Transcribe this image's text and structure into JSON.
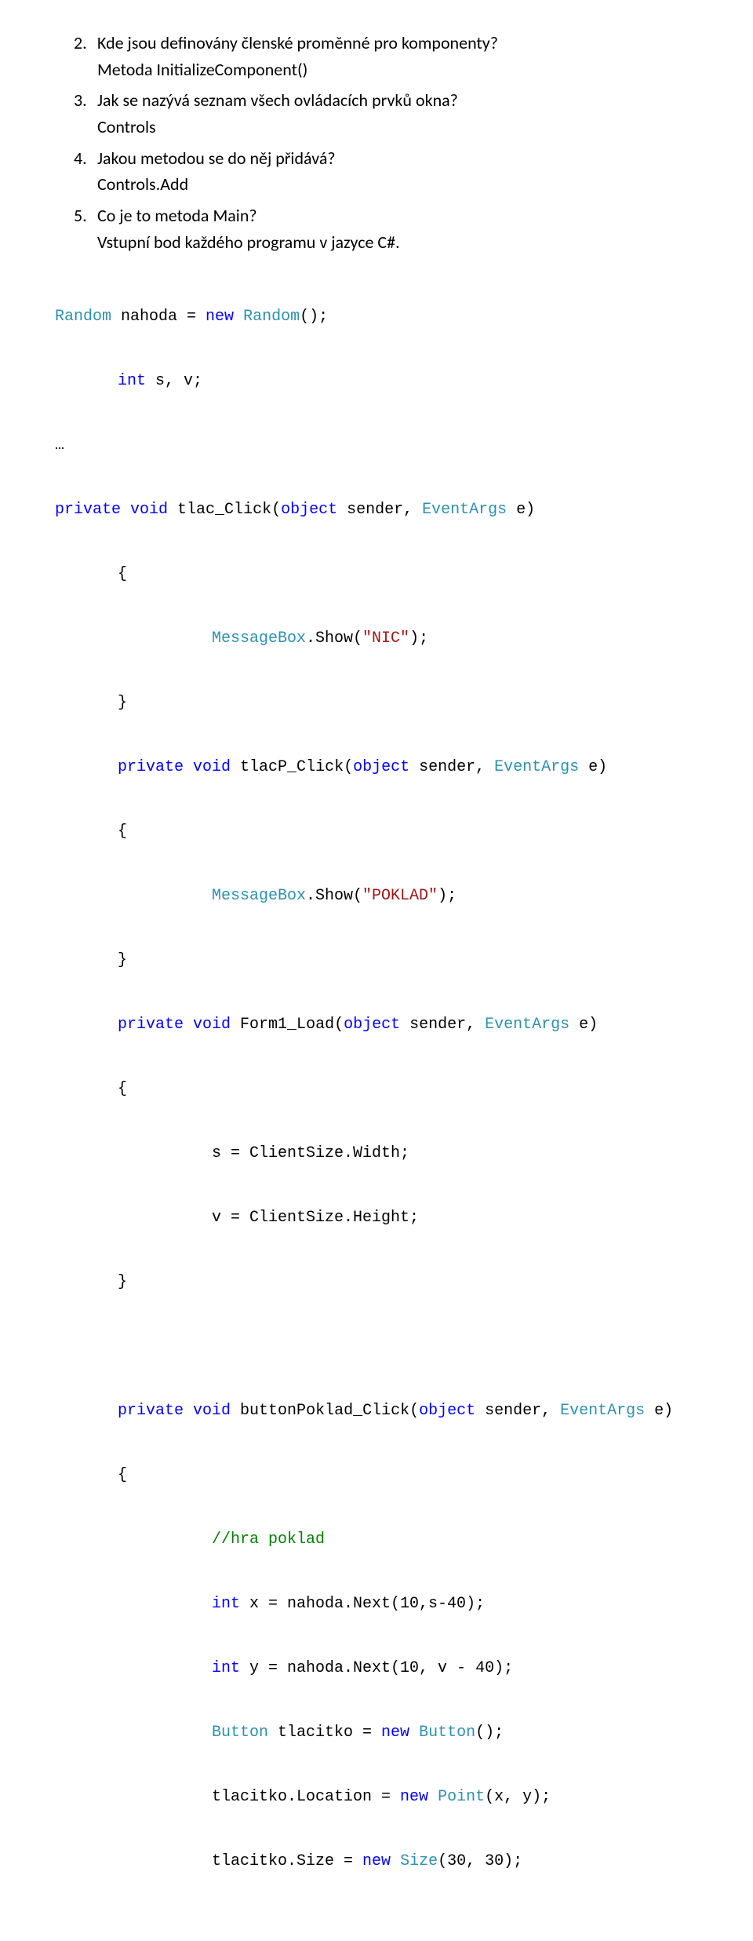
{
  "list": {
    "n2": "2.",
    "q2": "Kde jsou definovány členské proměnné pro komponenty?",
    "a2": "Metoda InitializeComponent()",
    "n3": "3.",
    "q3": "Jak se nazývá seznam všech ovládacích prvků okna?",
    "a3": "Controls",
    "n4": "4.",
    "q4": "Jakou metodou se do něj přidává?",
    "a4": "Controls.Add",
    "n5": "5.",
    "q5": "Co je to metoda Main?",
    "a5": "Vstupní bod každého programu v jazyce C#."
  },
  "code": {
    "l1_a": "Random",
    "l1_b": " nahoda = ",
    "l1_c": "new",
    "l1_d": " ",
    "l1_e": "Random",
    "l1_f": "();",
    "l2_a": "int",
    "l2_b": " s, v;",
    "l3": "…",
    "l4_a": "private",
    "l4_b": " ",
    "l4_c": "void",
    "l4_d": " tlac_Click(",
    "l4_e": "object",
    "l4_f": " sender, ",
    "l4_g": "EventArgs",
    "l4_h": " e)",
    "l5": "{",
    "l6_a": "MessageBox",
    "l6_b": ".Show(",
    "l6_c": "\"NIC\"",
    "l6_d": ");",
    "l7": "}",
    "l8_a": "private",
    "l8_b": " ",
    "l8_c": "void",
    "l8_d": " tlacP_Click(",
    "l8_e": "object",
    "l8_f": " sender, ",
    "l8_g": "EventArgs",
    "l8_h": " e)",
    "l9": "{",
    "l10_a": "MessageBox",
    "l10_b": ".Show(",
    "l10_c": "\"POKLAD\"",
    "l10_d": ");",
    "l11": "}",
    "l12_a": "private",
    "l12_b": " ",
    "l12_c": "void",
    "l12_d": " Form1_Load(",
    "l12_e": "object",
    "l12_f": " sender, ",
    "l12_g": "EventArgs",
    "l12_h": " e)",
    "l13": "{",
    "l14": "s = ClientSize.Width;",
    "l15": "v = ClientSize.Height;",
    "l16": "}",
    "l17_a": "private",
    "l17_b": " ",
    "l17_c": "void",
    "l17_d": " buttonPoklad_Click(",
    "l17_e": "object",
    "l17_f": " sender, ",
    "l17_g": "EventArgs",
    "l17_h": " e)",
    "l18": "{",
    "l19": "//hra poklad",
    "l20_a": "int",
    "l20_b": " x = nahoda.Next(10,s-40);",
    "l21_a": "int",
    "l21_b": " y = nahoda.Next(10, v - 40);",
    "l22_a": "Button",
    "l22_b": " tlacitko = ",
    "l22_c": "new",
    "l22_d": " ",
    "l22_e": "Button",
    "l22_f": "();",
    "l23_a": "tlacitko.Location = ",
    "l23_b": "new",
    "l23_c": " ",
    "l23_d": "Point",
    "l23_e": "(x, y);",
    "l24_a": "tlacitko.Size = ",
    "l24_b": "new",
    "l24_c": " ",
    "l24_d": "Size",
    "l24_e": "(30, 30);"
  }
}
